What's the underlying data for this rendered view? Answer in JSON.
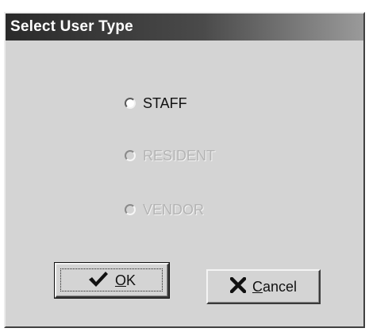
{
  "window": {
    "title": "Select User Type"
  },
  "user_types": [
    {
      "label": "STAFF",
      "enabled": true,
      "selected": false
    },
    {
      "label": "RESIDENT",
      "enabled": false,
      "selected": false
    },
    {
      "label": "VENDOR",
      "enabled": false,
      "selected": false
    }
  ],
  "buttons": {
    "ok_label": "OK",
    "ok_icon": "checkmark-icon",
    "cancel_label": "Cancel",
    "cancel_icon": "x-icon"
  }
}
